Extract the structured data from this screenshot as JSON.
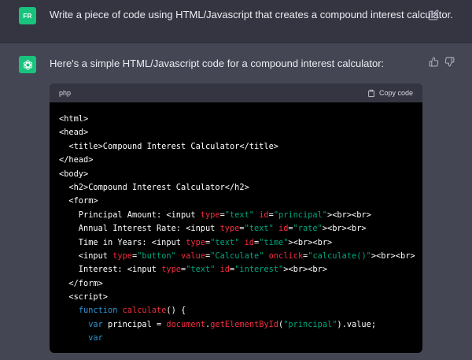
{
  "user_message": {
    "avatar_initials": "FR",
    "text": "Write a piece of code using HTML/Javascript that creates a compound interest calculator."
  },
  "assistant_message": {
    "text": "Here's a simple HTML/Javascript code for a compound interest calculator:"
  },
  "code_block": {
    "language": "php",
    "copy_label": "Copy code",
    "lines": [
      [
        {
          "t": "plain",
          "v": "<html>"
        }
      ],
      [
        {
          "t": "plain",
          "v": "<head>"
        }
      ],
      [
        {
          "t": "plain",
          "v": "  <title>Compound Interest Calculator</title>"
        }
      ],
      [
        {
          "t": "plain",
          "v": "</head>"
        }
      ],
      [
        {
          "t": "plain",
          "v": "<body>"
        }
      ],
      [
        {
          "t": "plain",
          "v": "  <h2>Compound Interest Calculator</h2>"
        }
      ],
      [
        {
          "t": "plain",
          "v": "  <form>"
        }
      ],
      [
        {
          "t": "plain",
          "v": "    Principal Amount: <input "
        },
        {
          "t": "attr",
          "v": "type"
        },
        {
          "t": "plain",
          "v": "="
        },
        {
          "t": "string",
          "v": "\"text\""
        },
        {
          "t": "plain",
          "v": " "
        },
        {
          "t": "attr",
          "v": "id"
        },
        {
          "t": "plain",
          "v": "="
        },
        {
          "t": "string",
          "v": "\"principal\""
        },
        {
          "t": "plain",
          "v": "><br><br>"
        }
      ],
      [
        {
          "t": "plain",
          "v": "    Annual Interest Rate: <input "
        },
        {
          "t": "attr",
          "v": "type"
        },
        {
          "t": "plain",
          "v": "="
        },
        {
          "t": "string",
          "v": "\"text\""
        },
        {
          "t": "plain",
          "v": " "
        },
        {
          "t": "attr",
          "v": "id"
        },
        {
          "t": "plain",
          "v": "="
        },
        {
          "t": "string",
          "v": "\"rate\""
        },
        {
          "t": "plain",
          "v": "><br><br>"
        }
      ],
      [
        {
          "t": "plain",
          "v": "    Time in Years: <input "
        },
        {
          "t": "attr",
          "v": "type"
        },
        {
          "t": "plain",
          "v": "="
        },
        {
          "t": "string",
          "v": "\"text\""
        },
        {
          "t": "plain",
          "v": " "
        },
        {
          "t": "attr",
          "v": "id"
        },
        {
          "t": "plain",
          "v": "="
        },
        {
          "t": "string",
          "v": "\"time\""
        },
        {
          "t": "plain",
          "v": "><br><br>"
        }
      ],
      [
        {
          "t": "plain",
          "v": "    <input "
        },
        {
          "t": "attr",
          "v": "type"
        },
        {
          "t": "plain",
          "v": "="
        },
        {
          "t": "string",
          "v": "\"button\""
        },
        {
          "t": "plain",
          "v": " "
        },
        {
          "t": "attr",
          "v": "value"
        },
        {
          "t": "plain",
          "v": "="
        },
        {
          "t": "string",
          "v": "\"Calculate\""
        },
        {
          "t": "plain",
          "v": " "
        },
        {
          "t": "attr",
          "v": "onclick"
        },
        {
          "t": "plain",
          "v": "="
        },
        {
          "t": "string",
          "v": "\"calculate()\""
        },
        {
          "t": "plain",
          "v": "><br><br>"
        }
      ],
      [
        {
          "t": "plain",
          "v": "    Interest: <input "
        },
        {
          "t": "attr",
          "v": "type"
        },
        {
          "t": "plain",
          "v": "="
        },
        {
          "t": "string",
          "v": "\"text\""
        },
        {
          "t": "plain",
          "v": " "
        },
        {
          "t": "attr",
          "v": "id"
        },
        {
          "t": "plain",
          "v": "="
        },
        {
          "t": "string",
          "v": "\"interest\""
        },
        {
          "t": "plain",
          "v": "><br><br>"
        }
      ],
      [
        {
          "t": "plain",
          "v": "  </form>"
        }
      ],
      [
        {
          "t": "plain",
          "v": "  <script>"
        }
      ],
      [
        {
          "t": "plain",
          "v": "    "
        },
        {
          "t": "keyword",
          "v": "function"
        },
        {
          "t": "plain",
          "v": " "
        },
        {
          "t": "func",
          "v": "calculate"
        },
        {
          "t": "plain",
          "v": "() {"
        }
      ],
      [
        {
          "t": "plain",
          "v": "      "
        },
        {
          "t": "keyword",
          "v": "var"
        },
        {
          "t": "plain",
          "v": " principal = "
        },
        {
          "t": "func",
          "v": "document"
        },
        {
          "t": "plain",
          "v": "."
        },
        {
          "t": "func",
          "v": "getElementById"
        },
        {
          "t": "plain",
          "v": "("
        },
        {
          "t": "string",
          "v": "\"principal\""
        },
        {
          "t": "plain",
          "v": ").value;"
        }
      ],
      [
        {
          "t": "plain",
          "v": "      "
        },
        {
          "t": "keyword",
          "v": "var"
        }
      ]
    ]
  },
  "colors": {
    "conversation_bg": "#444654",
    "user_row_bg": "#343541",
    "avatar_green": "#19c37d",
    "code_bg": "#000000",
    "token_attr": "#f22c3d",
    "token_string": "#00a67d",
    "token_keyword": "#2e95d3"
  },
  "icons": {
    "edit": "pencil-square-icon",
    "assistant_avatar": "openai-logo-icon",
    "thumbs_up": "thumbs-up-icon",
    "thumbs_down": "thumbs-down-icon",
    "copy": "clipboard-icon"
  }
}
